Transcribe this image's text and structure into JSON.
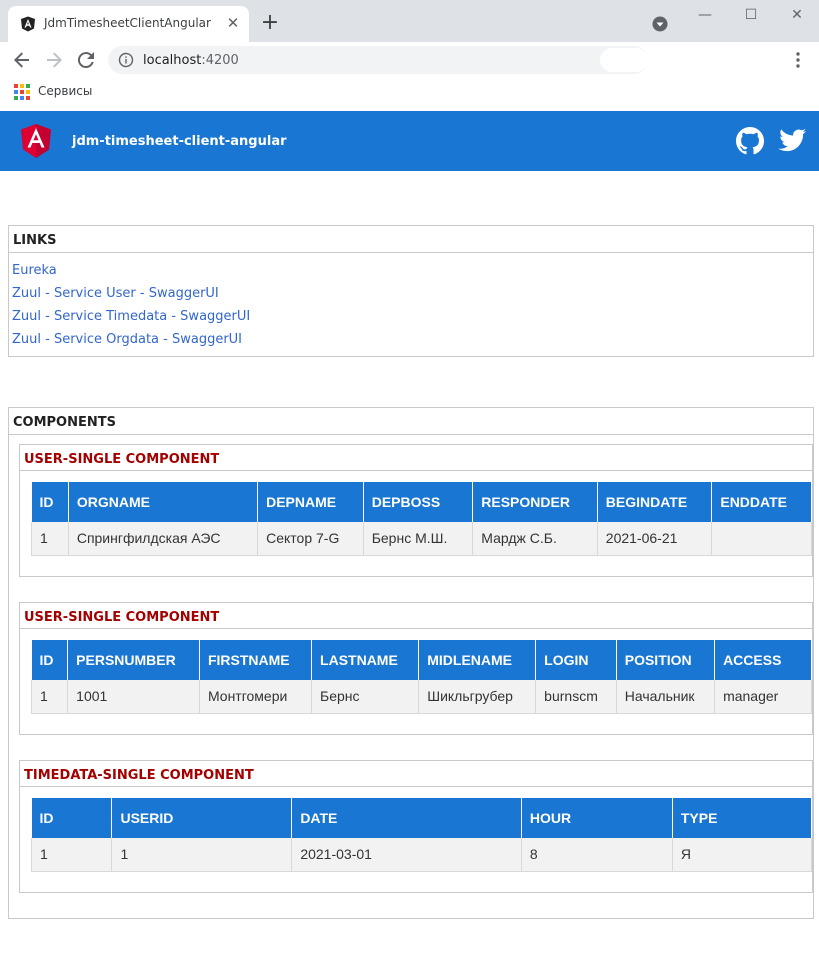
{
  "browser": {
    "tab_title": "JdmTimesheetClientAngular",
    "tab_close": "✕",
    "new_tab": "+",
    "url_host": "localhost",
    "url_port": ":4200",
    "bookmark_label": "Сервисы",
    "window_controls": [
      "—",
      "☐",
      "✕"
    ]
  },
  "header": {
    "title": "jdm-timesheet-client-angular",
    "logo_icon": "angular-logo",
    "brand_color": "#1976d2"
  },
  "links": {
    "title": "LINKS",
    "items": [
      "Eureka",
      "Zuul - Service User - SwaggerUI",
      "Zuul - Service Timedata - SwaggerUI",
      "Zuul - Service Orgdata - SwaggerUI"
    ]
  },
  "components": {
    "title": "COMPONENTS",
    "org": {
      "title": "USER-SINGLE COMPONENT",
      "columns": [
        "ID",
        "ORGNAME",
        "DEPNAME",
        "DEPBOSS",
        "RESPONDER",
        "BEGINDATE",
        "ENDDATE"
      ],
      "row": [
        "1",
        "Спрингфилдская АЭС",
        "Сектор 7-G",
        "Бернс М.Ш.",
        "Мардж С.Б.",
        "2021-06-21",
        ""
      ]
    },
    "user": {
      "title": "USER-SINGLE COMPONENT",
      "columns": [
        "ID",
        "PERSNUMBER",
        "FIRSTNAME",
        "LASTNAME",
        "MIDLENAME",
        "LOGIN",
        "POSITION",
        "ACCESS"
      ],
      "row": [
        "1",
        "1001",
        "Монтгомери",
        "Бернс",
        "Шикльгрубер",
        "burnscm",
        "Начальник",
        "manager"
      ]
    },
    "timedata": {
      "title": "TIMEDATA-SINGLE COMPONENT",
      "columns": [
        "ID",
        "USERID",
        "DATE",
        "HOUR",
        "TYPE"
      ],
      "row": [
        "1",
        "1",
        "2021-03-01",
        "8",
        "Я"
      ]
    }
  }
}
